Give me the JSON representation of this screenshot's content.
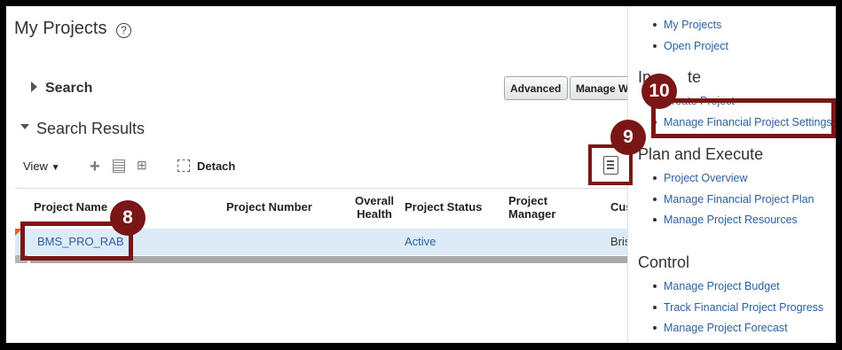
{
  "main": {
    "page_title": "My Projects",
    "help_glyph": "?",
    "search_label": "Search",
    "advanced_button": "Advanced",
    "manage_button": "Manage W",
    "search_results_title": "Search Results",
    "toolbar": {
      "view_label": "View",
      "add_icon": "plus-icon",
      "detach_label": "Detach"
    },
    "table": {
      "columns": [
        "Project Name",
        "Project Number",
        "Overall Health",
        "Project Status",
        "Project Manager",
        "Cus"
      ],
      "rows": [
        {
          "project_name": "BMS_PRO_RAB",
          "project_number": "",
          "overall_health": "",
          "project_status": "Active",
          "project_manager": "",
          "customer": "Bris"
        }
      ]
    }
  },
  "callouts": {
    "c8": "8",
    "c9": "9",
    "c10": "10"
  },
  "side_panel": {
    "top_links": [
      "My Projects",
      "Open Project"
    ],
    "initiate_heading_partial": "In",
    "initiate_heading_end": "te",
    "initiate_hidden_link": "Create Project",
    "initiate_link": "Manage Financial Project Settings",
    "plan_heading": "Plan and Execute",
    "plan_links": [
      "Project Overview",
      "Manage Financial Project Plan",
      "Manage Project Resources"
    ],
    "control_heading": "Control",
    "control_links": [
      "Manage Project Budget",
      "Track Financial Project Progress",
      "Manage Project Forecast"
    ]
  },
  "colors": {
    "callout": "#7a1616",
    "link": "#2b5f9e",
    "row_selected": "#dcebf7"
  }
}
